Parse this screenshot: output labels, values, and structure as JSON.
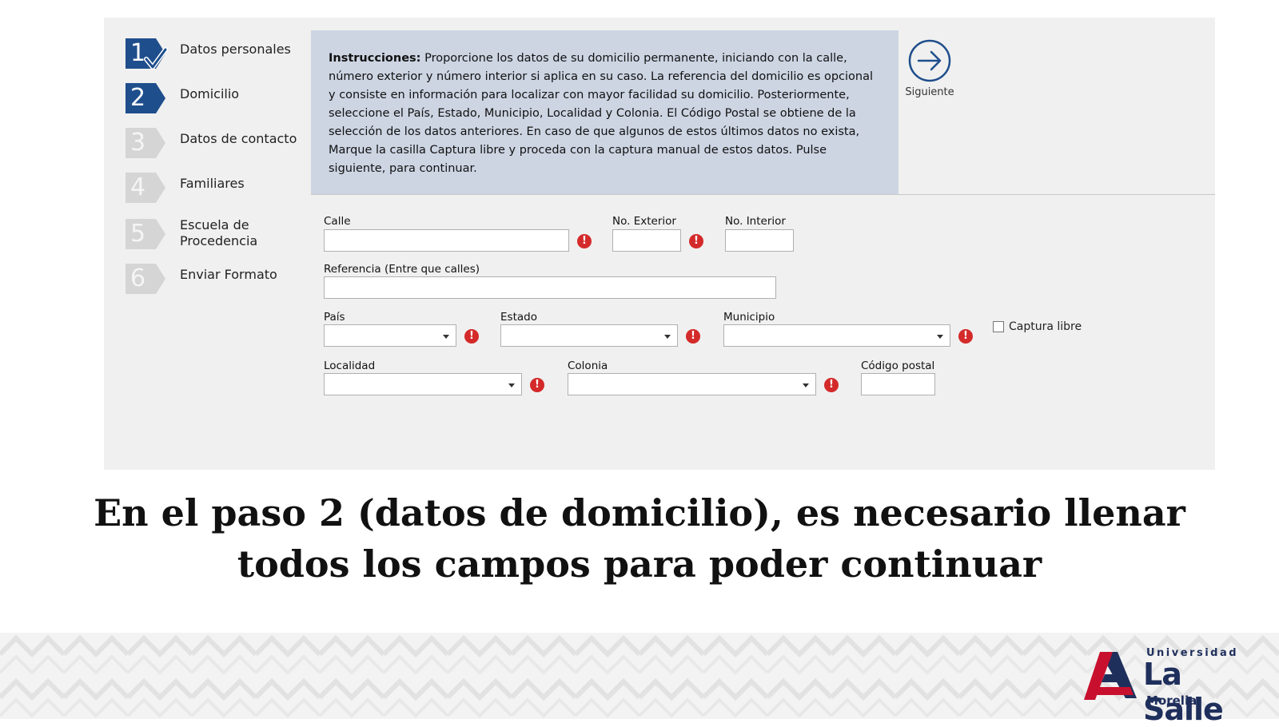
{
  "steps": [
    {
      "number": "1",
      "label": "Datos personales",
      "state": "completed"
    },
    {
      "number": "2",
      "label": "Domicilio",
      "state": "active"
    },
    {
      "number": "3",
      "label": "Datos de contacto",
      "state": "inactive"
    },
    {
      "number": "4",
      "label": "Familiares",
      "state": "inactive"
    },
    {
      "number": "5",
      "label": "Escuela de Procedencia",
      "state": "inactive"
    },
    {
      "number": "6",
      "label": "Enviar Formato",
      "state": "inactive"
    }
  ],
  "instructions": {
    "title": "Instrucciones:",
    "text": "Proporcione los datos de su domicilio permanente, iniciando con la calle, número exterior y número interior si aplica en su caso. La referencia del domicilio es opcional y consiste en información para localizar con mayor facilidad su domicilio. Posteriormente, seleccione el País, Estado, Municipio, Localidad y Colonia. El Código Postal se obtiene de la selección de los datos anteriores. En caso de que algunos de estos últimos datos no exista, Marque la casilla Captura libre y proceda con la captura manual de estos datos. Pulse siguiente, para continuar."
  },
  "next_button": {
    "label": "Siguiente"
  },
  "form": {
    "calle": {
      "label": "Calle",
      "value": ""
    },
    "no_exterior": {
      "label": "No. Exterior",
      "value": ""
    },
    "no_interior": {
      "label": "No. Interior",
      "value": ""
    },
    "referencia": {
      "label": "Referencia (Entre que calles)",
      "value": ""
    },
    "pais": {
      "label": "País",
      "value": ""
    },
    "estado": {
      "label": "Estado",
      "value": ""
    },
    "municipio": {
      "label": "Municipio",
      "value": ""
    },
    "captura_libre": {
      "label": "Captura libre",
      "checked": false
    },
    "localidad": {
      "label": "Localidad",
      "value": ""
    },
    "colonia": {
      "label": "Colonia",
      "value": ""
    },
    "codigo_postal": {
      "label": "Código postal",
      "value": ""
    },
    "error_glyph": "!"
  },
  "caption": "En el paso 2 (datos de domicilio), es necesario llenar todos los campos para poder continuar",
  "logo": {
    "line1": "Universidad",
    "line2": "La Salle",
    "line3": "Morelia"
  },
  "colors": {
    "accent": "#1f4e8c",
    "error": "#d42a2a",
    "instructions_bg": "#cdd5e3",
    "brand_red": "#c8102e",
    "brand_navy": "#1f2f5c"
  }
}
